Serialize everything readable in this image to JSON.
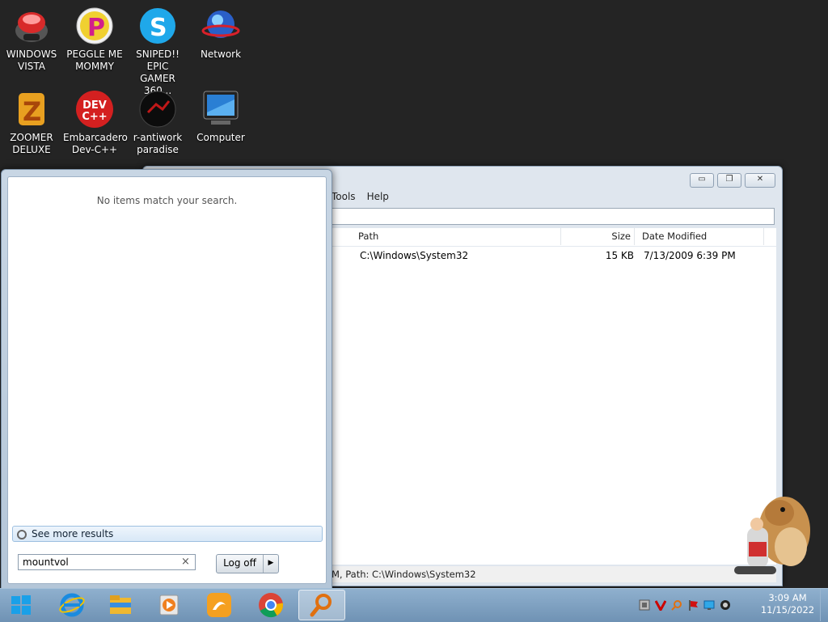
{
  "desktop": {
    "icons": [
      {
        "label": "WINDOWS\nVISTA",
        "icon": "vista-orb-icon"
      },
      {
        "label": "PEGGLE ME\nMOMMY",
        "icon": "peggle-icon"
      },
      {
        "label": "SNIPED!! EPIC\nGAMER 360...",
        "icon": "skype-icon"
      },
      {
        "label": "Network",
        "icon": "network-icon"
      },
      {
        "label": "ZOOMER\nDELUXE",
        "icon": "zoomer-icon"
      },
      {
        "label": "Embarcadero\nDev-C++",
        "icon": "devcpp-icon"
      },
      {
        "label": "r-antiwork\nparadise",
        "icon": "antiwork-icon"
      },
      {
        "label": "Computer",
        "icon": "computer-icon"
      }
    ]
  },
  "window": {
    "menu": [
      "Tools",
      "Help"
    ],
    "controls": {
      "minimize": "▭",
      "maximize": "❐",
      "close": "✕"
    },
    "columns": [
      "Path",
      "Size",
      "Date Modified"
    ],
    "rows": [
      {
        "path": "C:\\Windows\\System32",
        "size": "15 KB",
        "date": "7/13/2009 6:39 PM"
      }
    ],
    "status": "M, Path: C:\\Windows\\System32"
  },
  "start_menu": {
    "no_items": "No items match your search.",
    "see_more": "See more results",
    "search_value": "mountvol",
    "clear": "×",
    "logoff_label": "Log off",
    "logoff_arrow": "▶"
  },
  "taskbar": {
    "items": [
      "start-orb-icon",
      "internet-explorer-icon",
      "file-explorer-icon",
      "media-player-icon",
      "uc-browser-icon",
      "chrome-icon",
      "search-app-icon"
    ],
    "time": "3:09 AM",
    "date": "11/15/2022"
  }
}
